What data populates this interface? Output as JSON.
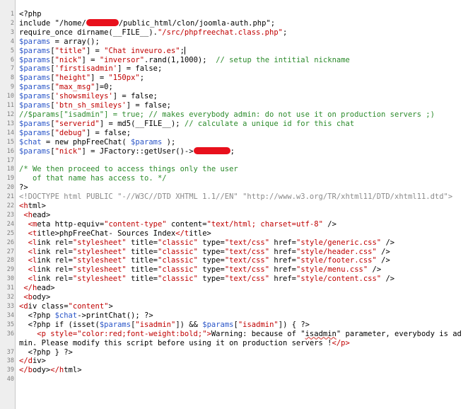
{
  "editor": {
    "title": "",
    "colors": {
      "variable": "#2a55c8",
      "string": "#c00000",
      "comment": "#2b8a2b",
      "tag": "#c00000",
      "gutter_bg": "#eeeeee",
      "redaction": "#e8101c"
    }
  },
  "lines": [
    {
      "n": "1",
      "t": "<?php"
    },
    {
      "n": "2",
      "a": "include \"/home/",
      "b": "/public_html/clon/joomla-auth.php\";"
    },
    {
      "n": "3",
      "t": "require_once dirname(__FILE__).\"/src/phpfreechat.class.php\";"
    },
    {
      "n": "4",
      "t": "$params = array();"
    },
    {
      "n": "5",
      "t": "$params[\"title\"] = \"Chat inveuro.es\";"
    },
    {
      "n": "6",
      "t": "$params[\"nick\"] = \"inversor\".rand(1,1000);  // setup the intitial nickname"
    },
    {
      "n": "7",
      "t": "$params['firstisadmin'] = false;"
    },
    {
      "n": "8",
      "t": "$params[\"height\"] = \"150px\";"
    },
    {
      "n": "9",
      "t": "$params[\"max_msg\"]=0;"
    },
    {
      "n": "10",
      "t": "$params['showsmileys'] = false;"
    },
    {
      "n": "11",
      "t": "$params['btn_sh_smileys'] = false;"
    },
    {
      "n": "12",
      "t": "//$params[\"isadmin\"] = true; // makes everybody admin: do not use it on production servers ;)"
    },
    {
      "n": "13",
      "t": "$params[\"serverid\"] = md5(__FILE__); // calculate a unique id for this chat"
    },
    {
      "n": "14",
      "t": "$params[\"debug\"] = false;"
    },
    {
      "n": "15",
      "t": "$chat = new phpFreeChat( $params );"
    },
    {
      "n": "16",
      "a": "$params[\"nick\"] = JFactory::getUser()->",
      "b": ";"
    },
    {
      "n": "17",
      "t": ""
    },
    {
      "n": "18",
      "t": "/* We then proceed to access things only the user"
    },
    {
      "n": "19",
      "t": "   of that name has access to. */"
    },
    {
      "n": "20",
      "t": "?>"
    },
    {
      "n": "21",
      "t": "<!DOCTYPE html PUBLIC \"-//W3C//DTD XHTML 1.1//EN\" \"http://www.w3.org/TR/xhtml11/DTD/xhtml11.dtd\">"
    },
    {
      "n": "22",
      "t": "<html>"
    },
    {
      "n": "23",
      "t": " <head>"
    },
    {
      "n": "24",
      "t": "  <meta http-equiv=\"content-type\" content=\"text/html; charset=utf-8\" />"
    },
    {
      "n": "25",
      "t": "  <title>phpFreeChat- Sources Index</title>"
    },
    {
      "n": "26",
      "t": "  <link rel=\"stylesheet\" title=\"classic\" type=\"text/css\" href=\"style/generic.css\" />"
    },
    {
      "n": "27",
      "t": "  <link rel=\"stylesheet\" title=\"classic\" type=\"text/css\" href=\"style/header.css\" />"
    },
    {
      "n": "28",
      "t": "  <link rel=\"stylesheet\" title=\"classic\" type=\"text/css\" href=\"style/footer.css\" />"
    },
    {
      "n": "29",
      "t": "  <link rel=\"stylesheet\" title=\"classic\" type=\"text/css\" href=\"style/menu.css\" />"
    },
    {
      "n": "30",
      "t": "  <link rel=\"stylesheet\" title=\"classic\" type=\"text/css\" href=\"style/content.css\" />"
    },
    {
      "n": "31",
      "t": " </head>"
    },
    {
      "n": "32",
      "t": " <body>"
    },
    {
      "n": "33",
      "t": "<div class=\"content\">"
    },
    {
      "n": "34",
      "t": "  <?php $chat->printChat(); ?>"
    },
    {
      "n": "35",
      "t": "  <?php if (isset($params[\"isadmin\"]) && $params[\"isadmin\"]) { ?>"
    },
    {
      "n": "36",
      "t": "    <p style=\"color:red;font-weight:bold;\">Warning: because of \"isadmin\" parameter, everybody is admin. Please modify this script before using it on production servers !</p>"
    },
    {
      "n": "37",
      "t": "  <?php } ?>"
    },
    {
      "n": "38",
      "t": "</div>"
    },
    {
      "n": "39",
      "t": "</body></html>"
    },
    {
      "n": "40",
      "t": ""
    }
  ]
}
